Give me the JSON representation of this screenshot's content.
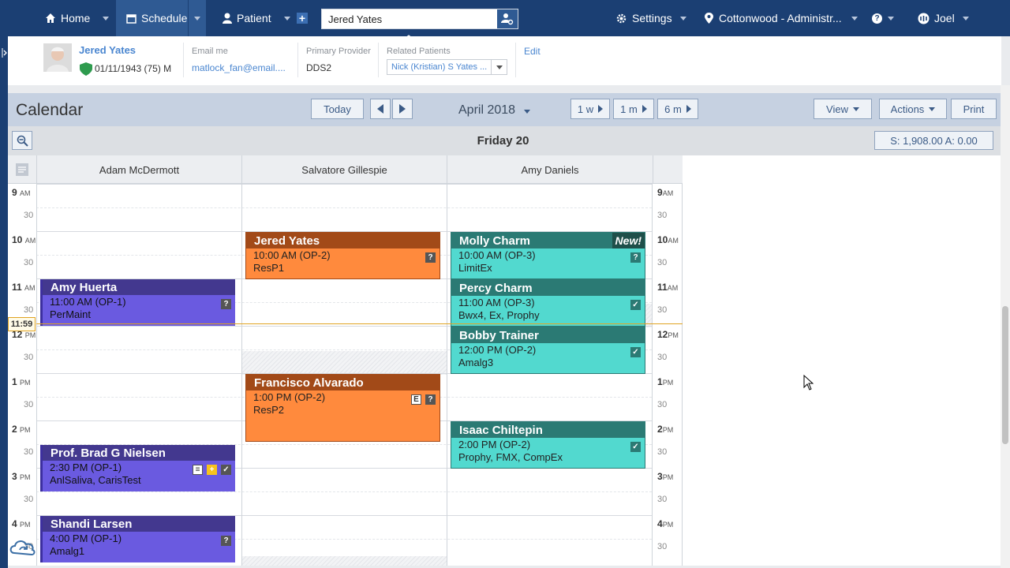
{
  "nav": {
    "home": "Home",
    "schedule": "Schedule",
    "patient": "Patient",
    "search_value": "Jered Yates",
    "settings": "Settings",
    "location": "Cottonwood - Administr...",
    "user": "Joel"
  },
  "patient": {
    "name": "Jered Yates",
    "dob": "01/11/1943 (75) M",
    "email_label": "Email me",
    "email": "matlock_fan@email....",
    "provider_label": "Primary Provider",
    "provider": "DDS2",
    "related_label": "Related Patients",
    "related_value": "Nick (Kristian) S Yates ...",
    "edit": "Edit"
  },
  "calendar": {
    "title": "Calendar",
    "today": "Today",
    "month": "April 2018",
    "week": "1 w",
    "month1": "1 m",
    "month6": "6 m",
    "view": "View",
    "actions": "Actions",
    "print": "Print",
    "day_title": "Friday 20",
    "totals": "S:  1,908.00   A:  0.00",
    "now": "11:59"
  },
  "columns": [
    "Adam McDermott",
    "Salvatore Gillespie",
    "Amy Daniels"
  ],
  "times": {
    "left": [
      {
        "h": "9",
        "ap": "AM"
      },
      {
        "h": "10",
        "ap": "AM"
      },
      {
        "h": "11",
        "ap": "AM"
      },
      {
        "h": "12",
        "ap": "PM"
      },
      {
        "h": "1",
        "ap": "PM"
      },
      {
        "h": "2",
        "ap": "PM"
      },
      {
        "h": "3",
        "ap": "PM"
      },
      {
        "h": "4",
        "ap": "PM"
      }
    ],
    "half": "30"
  },
  "appointments": [
    {
      "name": "Amy Huerta",
      "time": "11:00 AM  (OP-1)",
      "proc": "PerMaint"
    },
    {
      "name": "Prof. Brad G Nielsen",
      "time": "2:30 PM  (OP-1)",
      "proc": "AnlSaliva, CarisTest"
    },
    {
      "name": "Shandi Larsen",
      "time": "4:00 PM  (OP-1)",
      "proc": "Amalg1"
    },
    {
      "name": "Jered Yates",
      "time": "10:00 AM  (OP-2)",
      "proc": "ResP1"
    },
    {
      "name": "Francisco Alvarado",
      "time": "1:00 PM  (OP-2)",
      "proc": "ResP2"
    },
    {
      "name": "Molly Charm",
      "time": "10:00 AM  (OP-3)",
      "proc": "LimitEx",
      "tag": "New!"
    },
    {
      "name": "Percy Charm",
      "time": "11:00 AM  (OP-3)",
      "proc": "Bwx4, Ex, Prophy"
    },
    {
      "name": "Bobby Trainer",
      "time": "12:00 PM  (OP-2)",
      "proc": "Amalg3"
    },
    {
      "name": "Isaac Chiltepin",
      "time": "2:00 PM  (OP-2)",
      "proc": "Prophy, FMX, CompEx"
    }
  ],
  "icons": {
    "q": "?",
    "check": "✓",
    "e": "E",
    "plus": "+",
    "note": "≡"
  },
  "colors": {
    "nav": "#1b3f73",
    "purple": "#6a5ae0",
    "orange": "#ff8a3d",
    "teal": "#52d9cf",
    "now": "#e0a322"
  }
}
